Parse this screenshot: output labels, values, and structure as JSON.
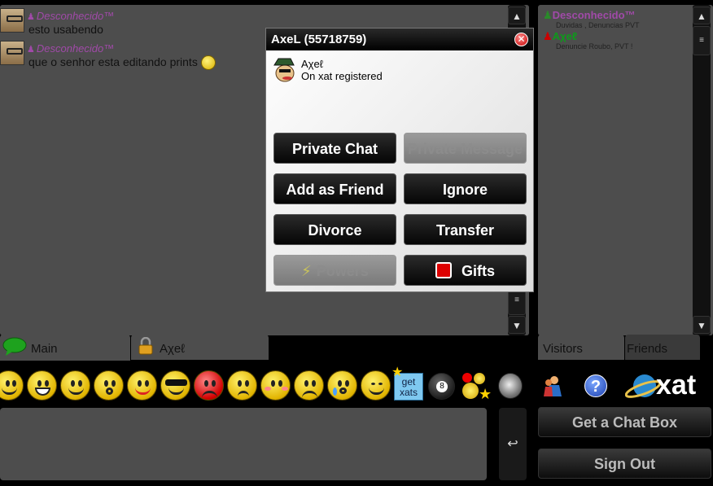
{
  "messages": [
    {
      "user": "Desconhecido™",
      "text": "esto usabendo"
    },
    {
      "user": "Desconhecido™",
      "text": "que o senhor esta editando prints"
    }
  ],
  "visitors": [
    {
      "name": "Desconhecido™",
      "status": "Duvidas , Denuncias PVT",
      "color": "#a04aa8"
    },
    {
      "name": "Aχeℓ",
      "status": "Denuncie Roubo, PVT !",
      "color": "#0d9a1a"
    }
  ],
  "tabs": {
    "main": "Main",
    "private": "Aχeℓ",
    "visitors": "Visitors",
    "friends": "Friends"
  },
  "popup": {
    "title": "AxeL (55718759)",
    "name": "Aχeℓ",
    "status": "On xat registered",
    "buttons": {
      "private_chat": "Private Chat",
      "private_message": "Private Message",
      "add_friend": "Add as Friend",
      "ignore": "Ignore",
      "divorce": "Divorce",
      "transfer": "Transfer",
      "powers": "Powers",
      "gifts": "Gifts"
    }
  },
  "bottom": {
    "get_xats": "get xats",
    "eight_ball": "8",
    "send_symbol": "↩",
    "get_chat_box": "Get a Chat Box",
    "sign_out": "Sign Out",
    "help": "?",
    "logo": "xat"
  },
  "colors": {
    "pane": "#4d4d4d",
    "background": "#000000",
    "name_purple": "#a04aa8",
    "name_green": "#0d9a1a"
  }
}
